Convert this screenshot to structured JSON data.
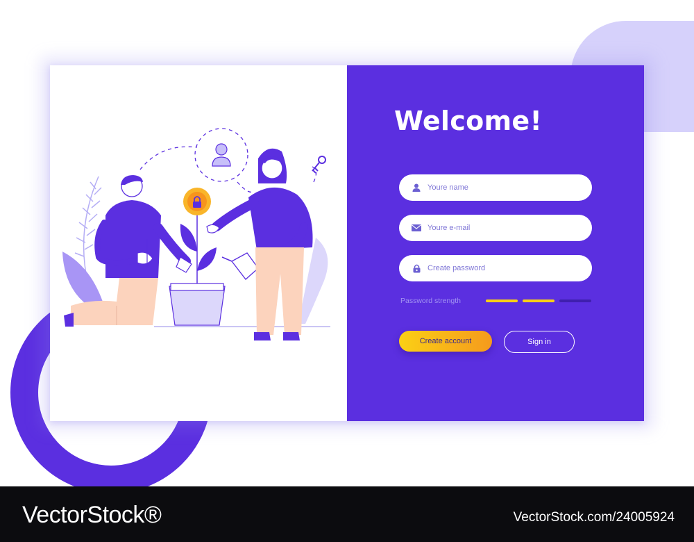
{
  "welcome": {
    "title": "Welcome!"
  },
  "form": {
    "name_placeholder": "Youre name",
    "email_placeholder": "Youre e-mail",
    "password_placeholder": "Create password",
    "icons": [
      "user-icon",
      "envelope-icon",
      "lock-icon"
    ]
  },
  "password_strength": {
    "label": "Password strength",
    "filled_segments": 2,
    "total_segments": 3
  },
  "buttons": {
    "create_account": "Create account",
    "sign_in": "Sign in"
  },
  "colors": {
    "primary": "#5b2fe0",
    "accent_yellow": "#fbd015",
    "accent_orange": "#f59a1d",
    "lavender": "#d6d1fb",
    "peach": "#fcd3bd",
    "strength_empty": "#3f1fae"
  },
  "illustration": {
    "elements": [
      "man-figure",
      "woman-figure",
      "plant-with-lock-flower",
      "user-avatar-icon",
      "key-icon",
      "leaf-decoration"
    ]
  },
  "watermark": {
    "logo": "VectorStock®",
    "id": "VectorStock.com/24005924"
  }
}
